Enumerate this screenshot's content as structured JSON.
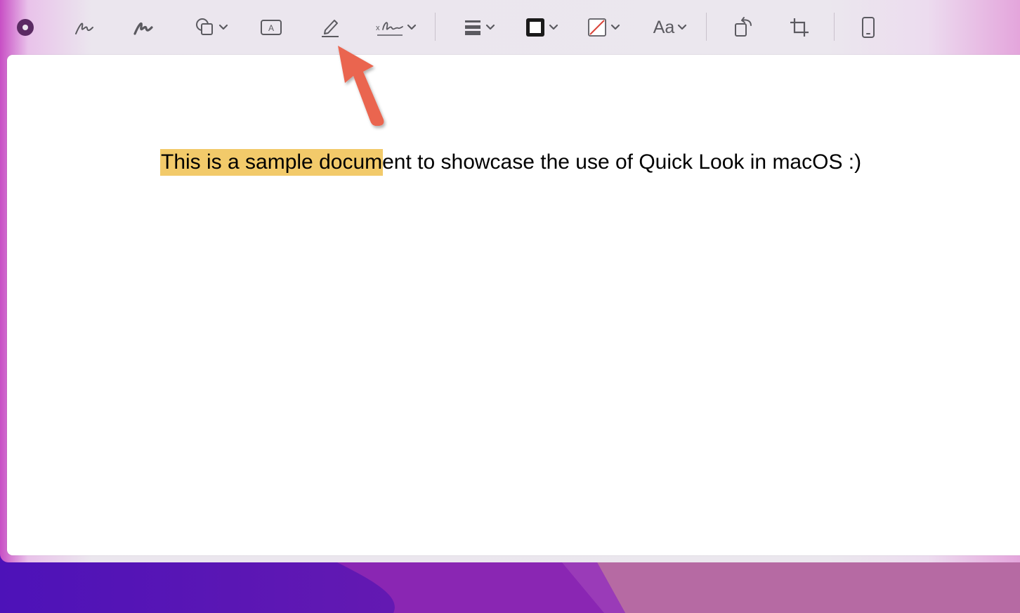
{
  "document": {
    "text": "This is a sample document to showcase the use of Quick Look in macOS :)"
  },
  "toolbar": {
    "text_style_label": "Aa"
  },
  "colors": {
    "highlight": "#f2ca6a",
    "arrow": "#ea6550",
    "icon": "#5b5a60"
  },
  "icons": {
    "markup": "markup-circle-icon",
    "sketch": "sketch-icon",
    "draw": "draw-icon",
    "shapes": "shapes-icon",
    "text": "text-box-icon",
    "highlight": "highlight-pen-icon",
    "sign": "signature-icon",
    "shape_style": "line-weight-icon",
    "border_color": "border-color-icon",
    "fill_color": "fill-color-icon",
    "rotate": "rotate-icon",
    "crop": "crop-icon",
    "device": "iphone-icon"
  }
}
